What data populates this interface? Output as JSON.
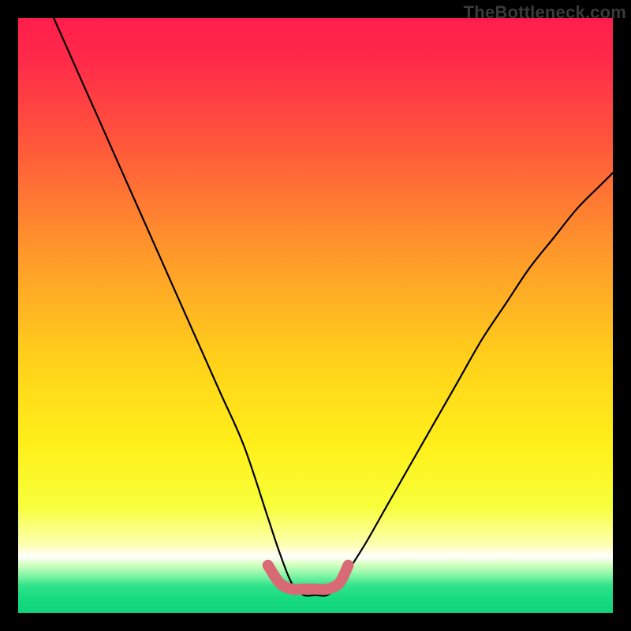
{
  "watermark": {
    "text": "TheBottleneck.com"
  },
  "colors": {
    "background_black": "#000000",
    "curve_black": "#000000",
    "bump_pink": "#d96a75",
    "gradient_stops": [
      {
        "at": 0.0,
        "color": "#ff1e4b"
      },
      {
        "at": 0.07,
        "color": "#ff2a4a"
      },
      {
        "at": 0.22,
        "color": "#ff5a3a"
      },
      {
        "at": 0.4,
        "color": "#ff9a2a"
      },
      {
        "at": 0.58,
        "color": "#ffd21a"
      },
      {
        "at": 0.72,
        "color": "#fff01a"
      },
      {
        "at": 0.82,
        "color": "#f7ff3a"
      },
      {
        "at": 0.885,
        "color": "#fdffb0"
      },
      {
        "at": 0.905,
        "color": "#ffffff"
      },
      {
        "at": 0.918,
        "color": "#d8ffc2"
      },
      {
        "at": 0.935,
        "color": "#8cf7a8"
      },
      {
        "at": 0.955,
        "color": "#2ee28a"
      },
      {
        "at": 0.975,
        "color": "#18db80"
      },
      {
        "at": 1.0,
        "color": "#10d47a"
      }
    ]
  },
  "chart_data": {
    "type": "line",
    "title": "",
    "xlabel": "",
    "ylabel": "",
    "xlim": [
      0,
      100
    ],
    "ylim": [
      0,
      100
    ],
    "grid": false,
    "legend": false,
    "series": [
      {
        "name": "bottleneck-curve",
        "x": [
          6,
          10,
          14,
          18,
          22,
          26,
          30,
          34,
          38,
          42,
          44,
          46,
          48,
          50,
          52,
          54,
          58,
          62,
          66,
          70,
          74,
          78,
          82,
          86,
          90,
          94,
          98,
          100
        ],
        "y": [
          100,
          91,
          82,
          73,
          64,
          55,
          46,
          37,
          28,
          16,
          10,
          5,
          3,
          3,
          3,
          5,
          11,
          18,
          25,
          32,
          39,
          46,
          52,
          58,
          63,
          68,
          72,
          74
        ]
      },
      {
        "name": "valley-bump",
        "x": [
          42,
          44,
          46,
          48,
          50,
          52,
          54,
          55.5
        ],
        "y": [
          8,
          5,
          4,
          4,
          4,
          4,
          5,
          8
        ]
      }
    ]
  }
}
